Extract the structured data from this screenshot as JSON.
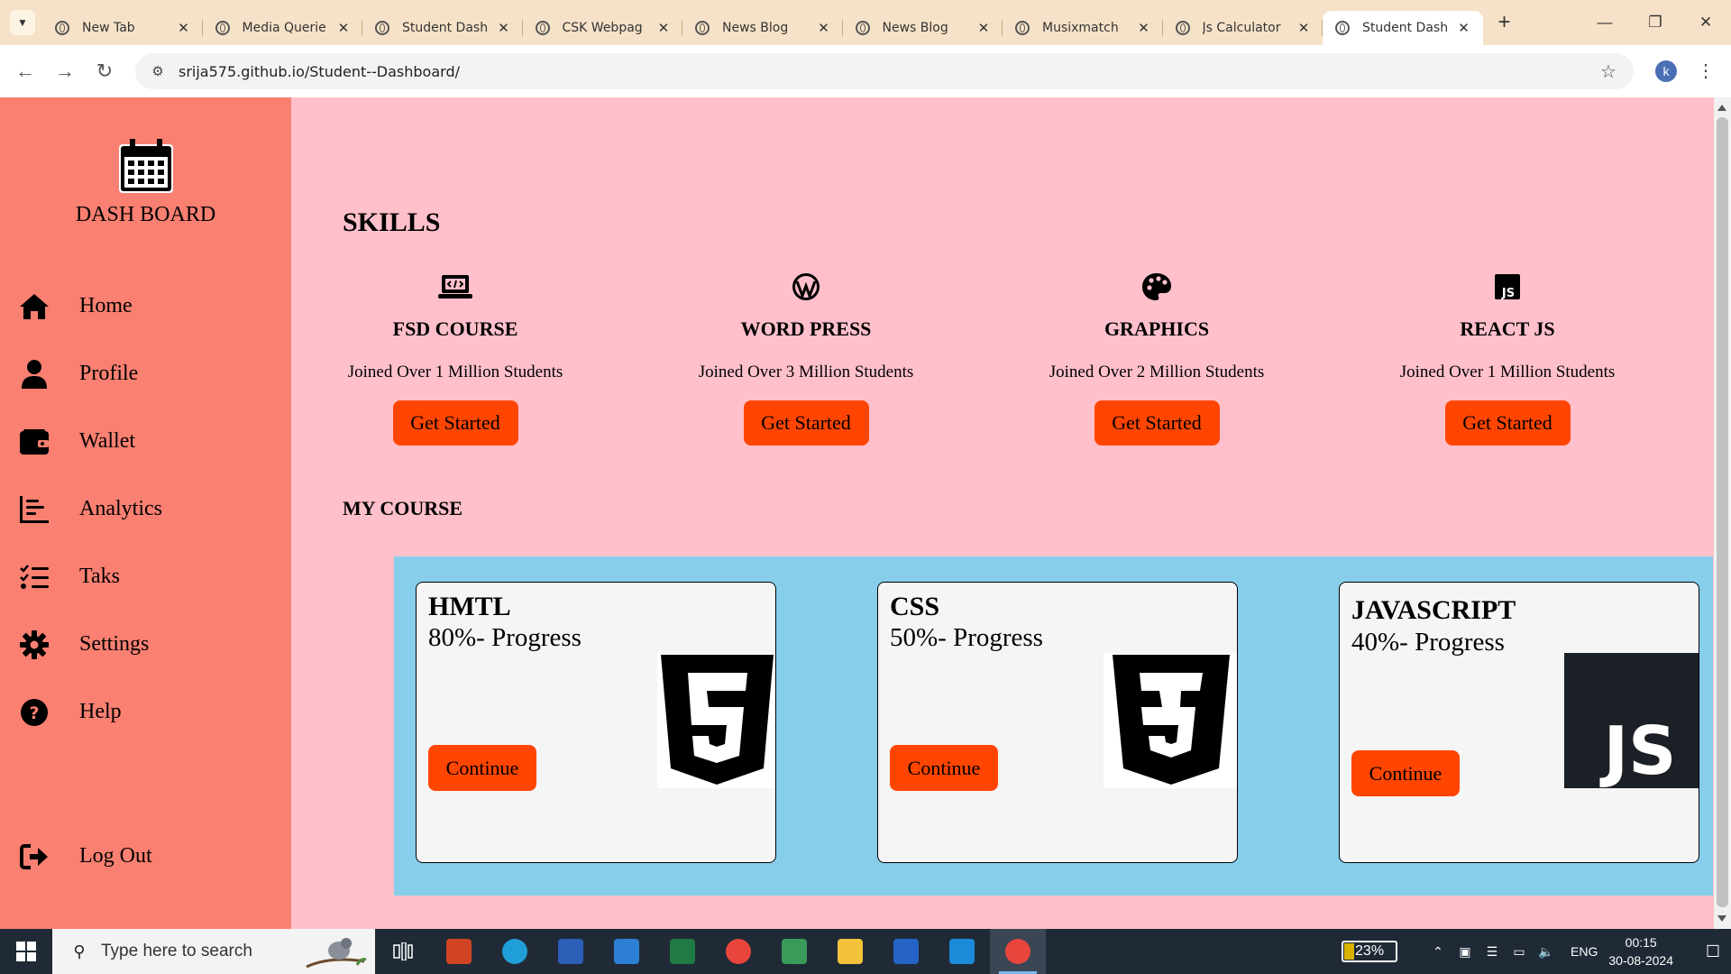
{
  "browser": {
    "tabs": [
      {
        "title": "New Tab",
        "active": false
      },
      {
        "title": "Media Querie",
        "active": false
      },
      {
        "title": "Student Dash",
        "active": false
      },
      {
        "title": "CSK Webpag",
        "active": false
      },
      {
        "title": "News Blog",
        "active": false
      },
      {
        "title": "News Blog",
        "active": false
      },
      {
        "title": "Musixmatch",
        "active": false
      },
      {
        "title": "Js Calculator",
        "active": false
      },
      {
        "title": "Student Dash",
        "active": true
      }
    ],
    "new_tab_label": "+",
    "url": "srija575.github.io/Student--Dashboard/",
    "profile_initial": "k"
  },
  "sidebar": {
    "brand": "DASH BOARD",
    "items": [
      {
        "label": "Home",
        "icon": "home-icon"
      },
      {
        "label": "Profile",
        "icon": "user-icon"
      },
      {
        "label": "Wallet",
        "icon": "wallet-icon"
      },
      {
        "label": "Analytics",
        "icon": "analytics-icon"
      },
      {
        "label": "Taks",
        "icon": "task-list-icon"
      },
      {
        "label": "Settings",
        "icon": "gear-icon"
      },
      {
        "label": "Help",
        "icon": "help-icon"
      }
    ],
    "logout": {
      "label": "Log Out",
      "icon": "logout-icon"
    }
  },
  "skills": {
    "title": "SKILLS",
    "items": [
      {
        "name": "FSD COURSE",
        "desc": "Joined Over 1 Million Students",
        "button": "Get Started",
        "icon": "laptop-code-icon"
      },
      {
        "name": "WORD PRESS",
        "desc": "Joined Over 3 Million Students",
        "button": "Get Started",
        "icon": "wordpress-icon"
      },
      {
        "name": "GRAPHICS",
        "desc": "Joined Over 2 Million Students",
        "button": "Get Started",
        "icon": "palette-icon"
      },
      {
        "name": "REACT JS",
        "desc": "Joined Over 1 Million Students",
        "button": "Get Started",
        "icon": "js-square-icon"
      }
    ]
  },
  "my_course": {
    "title": "MY COURSE",
    "cards": [
      {
        "name": "HMTL",
        "progress": "80%- Progress",
        "button": "Continue",
        "logo": "html5-logo-icon"
      },
      {
        "name": "CSS",
        "progress": "50%- Progress",
        "button": "Continue",
        "logo": "css3-logo-icon"
      },
      {
        "name": "JAVASCRIPT",
        "progress": "40%- Progress",
        "button": "Continue",
        "logo": "js-logo-icon",
        "logo_text": "JS"
      }
    ]
  },
  "taskbar": {
    "search_placeholder": "Type here to search",
    "battery_label": "23%",
    "battery_level": 0.23,
    "language": "ENG",
    "time": "00:15",
    "date": "30-08-2024"
  },
  "colors": {
    "sidebar_bg": "#fa8072",
    "main_bg": "#ffc0cb",
    "button_bg": "#ff4500",
    "course_band_bg": "#87ceeb"
  }
}
